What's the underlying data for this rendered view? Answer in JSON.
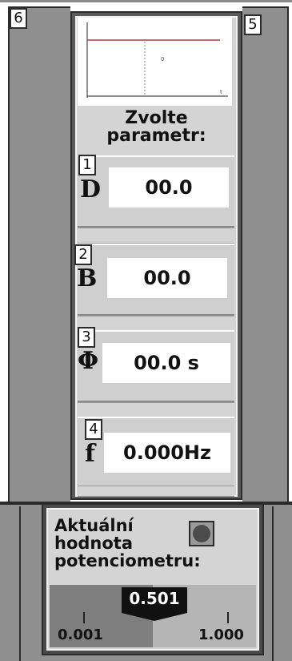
{
  "corner_labels": {
    "left": "6",
    "right": "5"
  },
  "graph": {
    "label_small": "0",
    "axis_label": "t"
  },
  "prompt": {
    "line1": "Zvolte",
    "line2": "parametr:"
  },
  "params": [
    {
      "index": "1",
      "symbol": "D",
      "value": "00.0"
    },
    {
      "index": "2",
      "symbol": "B",
      "value": "00.0"
    },
    {
      "index": "3",
      "symbol": "Φ",
      "value": "00.0 s"
    },
    {
      "index": "4",
      "symbol": "f",
      "value": "0.000Hz"
    }
  ],
  "potentiometer": {
    "title_line1": "Aktuální",
    "title_line2": "hodnota",
    "title_line3": "potenciometru:",
    "value": "0.501",
    "min_label": "0.001",
    "max_label": "1.000",
    "fill_fraction": 0.501
  },
  "colors": {
    "panel_bg": "#d4d4d4",
    "frame_dark": "#2b2b2b",
    "side_grey": "#8f8f8f",
    "graph_line": "#b43a3a"
  }
}
